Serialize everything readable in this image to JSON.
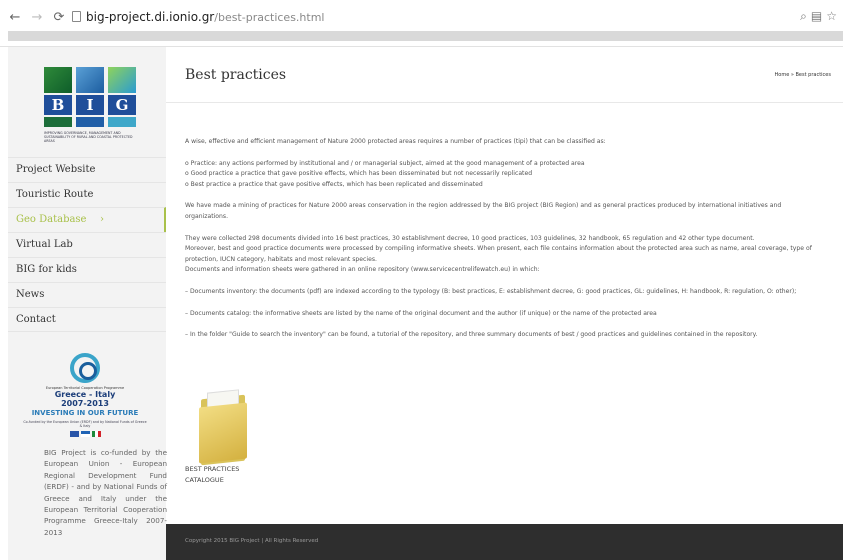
{
  "browser": {
    "url_host": "big-project.di.ionio.gr",
    "url_path": "/best-practices.html",
    "back_icon": "arrow-left-icon",
    "forward_icon": "arrow-right-icon",
    "reload_icon": "reload-icon"
  },
  "logo": {
    "letters": [
      "B",
      "I",
      "G"
    ],
    "caption": "IMPROVING GOVERNANCE, MANAGEMENT AND SUSTAINABILITY OF RURAL AND COASTAL PROTECTED AREAS"
  },
  "sidebar": {
    "items": [
      {
        "label": "Project Website"
      },
      {
        "label": "Touristic Route"
      },
      {
        "label": "Geo Database",
        "chevron": "›"
      },
      {
        "label": "Virtual Lab"
      },
      {
        "label": "BIG for kids"
      },
      {
        "label": "News"
      },
      {
        "label": "Contact"
      }
    ],
    "program": {
      "line1": "European Territorial Cooperation Programme",
      "line2": "Greece - Italy",
      "line3": "2007-2013",
      "line4": "INVESTING IN OUR FUTURE",
      "line5": "Co-funded by the European Union (ERDF) and by National Funds of Greece & Italy"
    },
    "cofund_text": "BIG Project is co-funded by the European Union - European Regional Development Fund (ERDF) - and by National Funds of Greece and Italy under the European Territorial Cooperation Programme Greece-Italy 2007-2013"
  },
  "header": {
    "title": "Best practices",
    "breadcrumb": "Home » Best practices"
  },
  "content": {
    "intro": "A wise, effective and efficient management of Nature 2000 protected areas requires a number of practices (tipi) that can be classified as:",
    "def1": "o Practice: any actions performed by institutional and / or managerial subject, aimed at the good management of a protected area",
    "def2": "o Good practice a practice that gave positive effects, which has been disseminated but not necessarily replicated",
    "def3": "o Best practice a practice that gave positive effects, which has been replicated and disseminated",
    "mining": "We have made a mining of practices for Nature 2000 areas conservation in the region addressed by the BIG project (BIG Region) and as general practices produced by international initiatives and organizations.",
    "collected1": "They were collected 298 documents divided into 16 best practices, 30 establishment decree, 10 good practices, 103 guidelines, 32 handbook, 65 regulation and 42 other type document.",
    "collected2": "Moreover, best and good practice documents were processed by compiling informative sheets. When present, each file contains information about the protected area such as name, areal coverage, type of protection, IUCN category, habitats and most relevant species.",
    "collected3": "Documents and information sheets were gathered in an online repository (www.servicecentrelifewatch.eu) in which:",
    "bullet1": "– Documents inventory: the documents (pdf) are indexed according to the typology (B: best practices, E: establishment decree, G: good practices, GL: guidelines, H: handbook, R: regulation, O: other);",
    "bullet2": "– Documents catalog: the informative sheets are listed by the name of the original document and the author (if unique) or the name of the protected area",
    "bullet3": "– In the folder \"Guide to search the inventory\" can be found, a tutorial of the repository, and three summary documents of best / good practices and guidelines contained in the repository.",
    "folder_label_1": "BEST PRACTICES",
    "folder_label_2": "CATALOGUE"
  },
  "footer": {
    "copyright": "Copyright 2015 BIG Project | All Rights Reserved"
  },
  "colors": {
    "accent": "#a9c14b",
    "footer_bg": "#2e2e2e",
    "sidebar_bg": "#f3f3f3"
  }
}
